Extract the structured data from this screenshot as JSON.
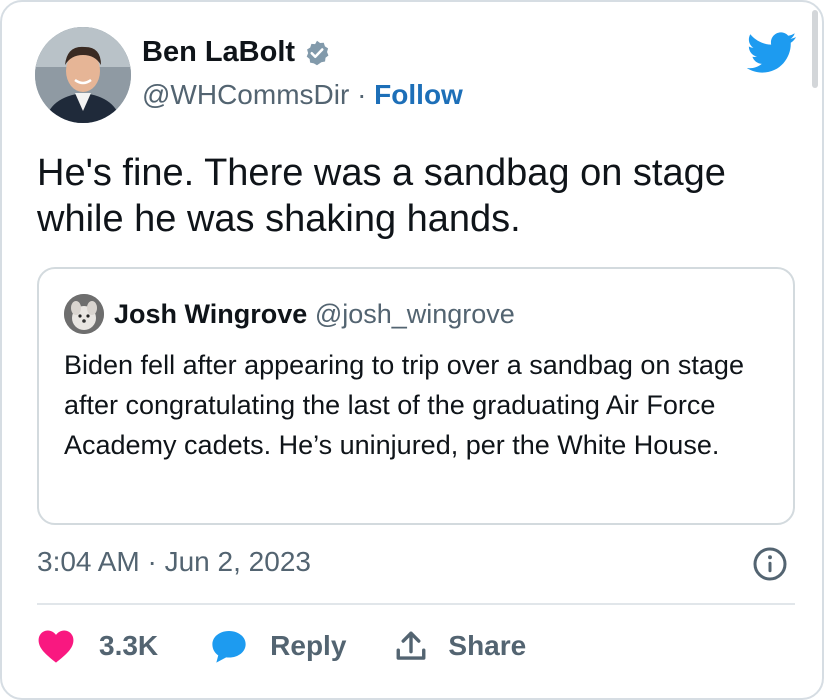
{
  "author": {
    "name": "Ben LaBolt",
    "handle": "@WHCommsDir",
    "separator": "·",
    "follow_label": "Follow",
    "verified_icon": "verified-badge-icon"
  },
  "tweet": {
    "text": "He's fine. There was a sandbag on stage while he was shaking hands."
  },
  "quoted_tweet": {
    "name": "Josh Wingrove",
    "handle": "@josh_wingrove",
    "text": "Biden fell after appearing to trip over a sandbag on stage after congratulating the last of the graduating Air Force Academy cadets. He’s uninjured, per the White House."
  },
  "meta": {
    "timestamp": "3:04 AM · Jun 2, 2023"
  },
  "actions": {
    "like_count": "3.3K",
    "reply_label": "Reply",
    "share_label": "Share"
  },
  "colors": {
    "twitter_blue": "#1d9bf0",
    "like_red": "#f91880",
    "follow_blue": "#1d6fb8",
    "secondary_text": "#536471"
  }
}
